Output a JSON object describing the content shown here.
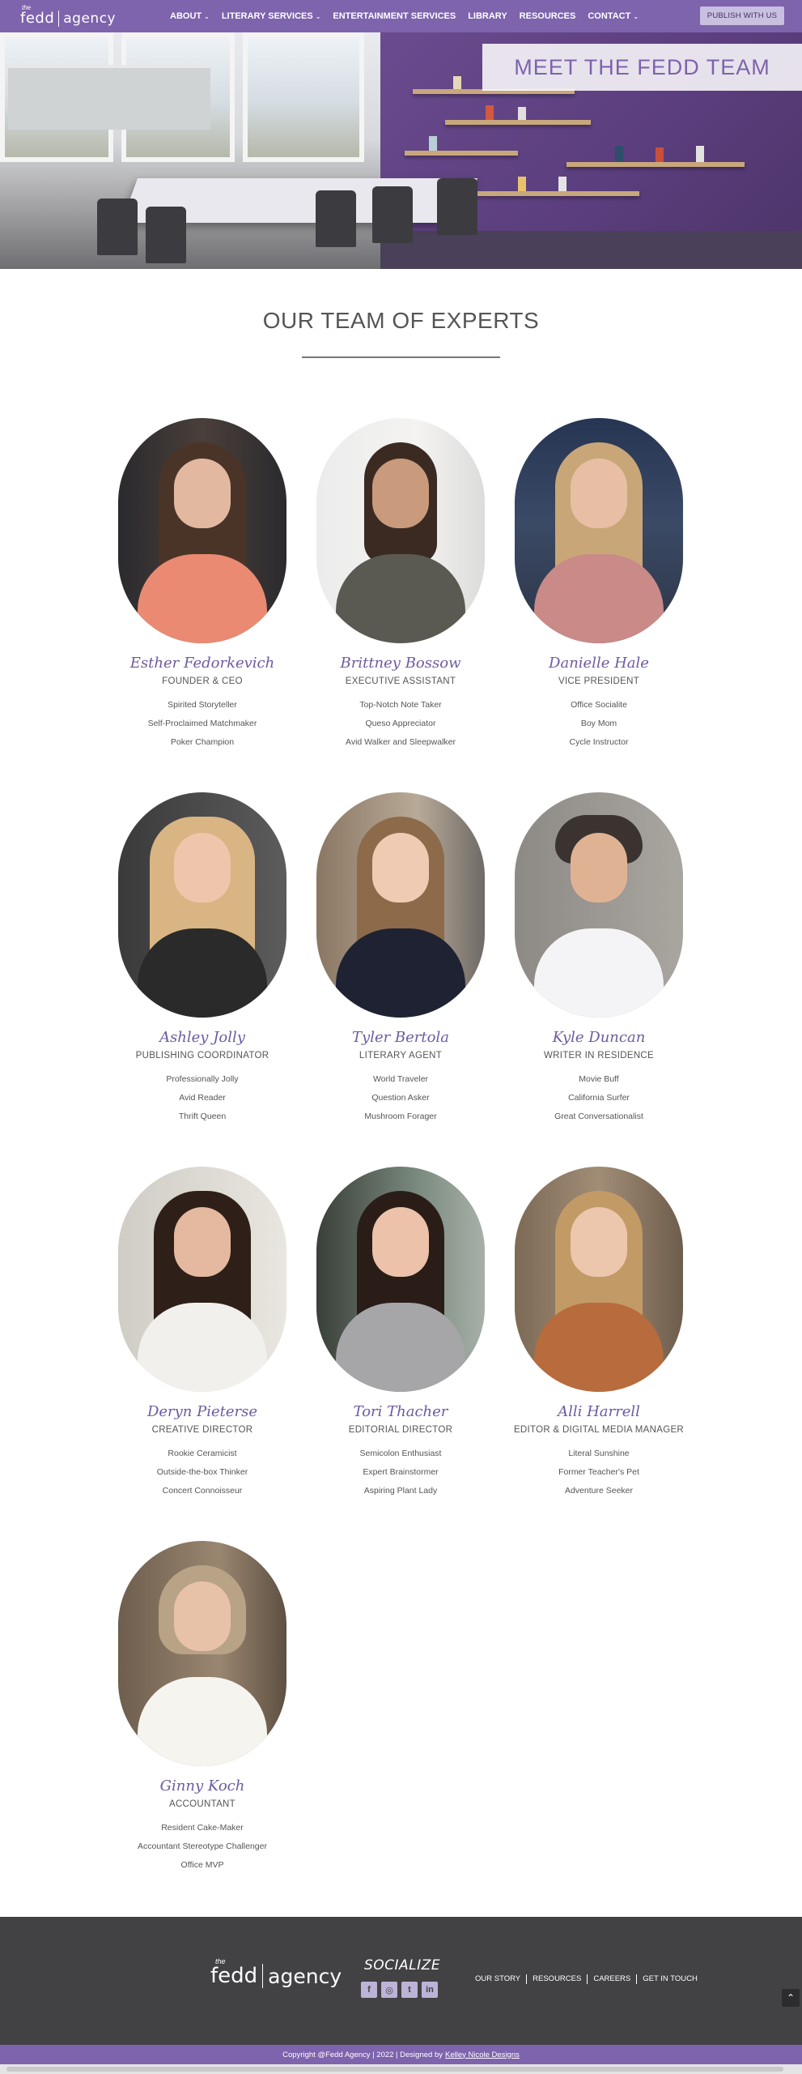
{
  "header": {
    "logo": {
      "the": "the",
      "fedd": "fedd",
      "agency": "agency"
    },
    "nav": [
      {
        "label": "ABOUT",
        "has_dropdown": true
      },
      {
        "label": "LITERARY SERVICES",
        "has_dropdown": true
      },
      {
        "label": "ENTERTAINMENT SERVICES",
        "has_dropdown": false
      },
      {
        "label": "LIBRARY",
        "has_dropdown": false
      },
      {
        "label": "RESOURCES",
        "has_dropdown": false
      },
      {
        "label": "CONTACT",
        "has_dropdown": true
      }
    ],
    "chevron": "⌄",
    "publish_button": "PUBLISH WITH US",
    "background_color": "#7e63ad"
  },
  "hero": {
    "title": "MEET THE FEDD TEAM"
  },
  "team_section": {
    "title": "OUR TEAM OF EXPERTS"
  },
  "team": [
    {
      "name": "Esther Fedorkevich",
      "role": "FOUNDER & CEO",
      "facts": [
        "Spirited Storyteller",
        "Self-Proclaimed Matchmaker",
        "Poker Champion"
      ]
    },
    {
      "name": "Brittney Bossow",
      "role": "EXECUTIVE ASSISTANT",
      "facts": [
        "Top-Notch Note Taker",
        "Queso Appreciator",
        "Avid Walker and Sleepwalker"
      ]
    },
    {
      "name": "Danielle Hale",
      "role": "VICE PRESIDENT",
      "facts": [
        "Office Socialite",
        "Boy Mom",
        "Cycle Instructor"
      ]
    },
    {
      "name": "Ashley Jolly",
      "role": "PUBLISHING COORDINATOR",
      "facts": [
        "Professionally Jolly",
        "Avid Reader",
        "Thrift Queen"
      ]
    },
    {
      "name": "Tyler Bertola",
      "role": "LITERARY AGENT",
      "facts": [
        "World Traveler",
        "Question Asker",
        "Mushroom Forager"
      ]
    },
    {
      "name": "Kyle Duncan",
      "role": "WRITER IN RESIDENCE",
      "facts": [
        "Movie Buff",
        "California Surfer",
        "Great Conversationalist"
      ]
    },
    {
      "name": "Deryn Pieterse",
      "role": "CREATIVE DIRECTOR",
      "facts": [
        "Rookie Ceramicist",
        "Outside-the-box Thinker",
        "Concert Connoisseur"
      ]
    },
    {
      "name": "Tori Thacher",
      "role": "EDITORIAL DIRECTOR",
      "facts": [
        "Semicolon Enthusiast",
        "Expert Brainstormer",
        "Aspiring Plant Lady"
      ]
    },
    {
      "name": "Alli Harrell",
      "role": "EDITOR & DIGITAL MEDIA MANAGER",
      "facts": [
        "Literal Sunshine",
        "Former Teacher's Pet",
        "Adventure Seeker"
      ]
    },
    {
      "name": "Ginny Koch",
      "role": "ACCOUNTANT",
      "facts": [
        "Resident Cake-Maker",
        "Accountant Stereotype Challenger",
        "Office MVP"
      ]
    }
  ],
  "footer": {
    "logo": {
      "the": "the",
      "fedd": "fedd",
      "agency": "agency"
    },
    "socialize_label": "SOCIALIZE",
    "social_icons": [
      {
        "icon": "facebook-icon",
        "glyph": "f"
      },
      {
        "icon": "instagram-icon",
        "glyph": "◎"
      },
      {
        "icon": "twitter-icon",
        "glyph": "t"
      },
      {
        "icon": "linkedin-icon",
        "glyph": "in"
      }
    ],
    "links": [
      "OUR STORY",
      "RESOURCES",
      "CAREERS",
      "GET IN TOUCH"
    ],
    "back_to_top_glyph": "⌃",
    "copyright": "Copyright @Fedd Agency | 2022 | Designed by",
    "designer": "Kelley Nicole Designs",
    "background_color": "#424144",
    "accent_color": "#7e63ad"
  }
}
